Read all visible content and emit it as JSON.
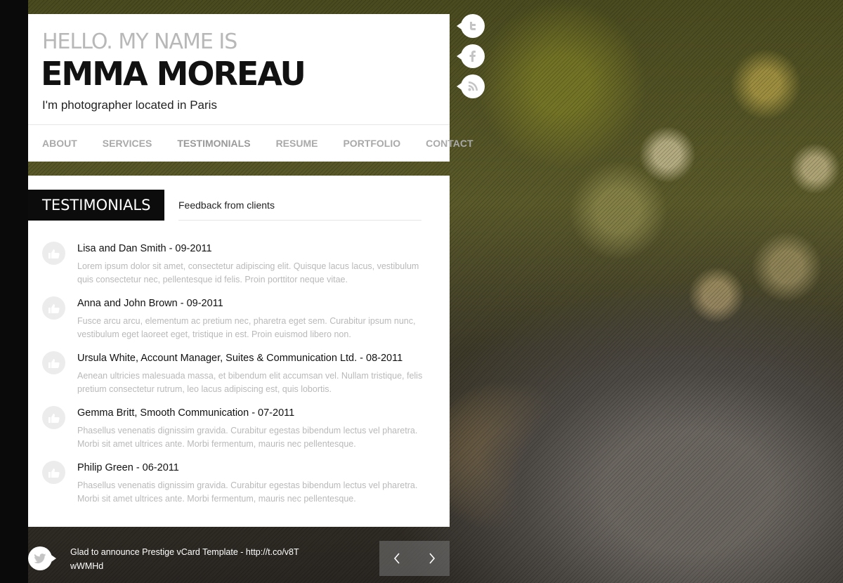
{
  "header": {
    "greeting": "HELLO. MY NAME IS",
    "name": "EMMA MOREAU",
    "tagline": "I'm photographer located in Paris"
  },
  "nav": {
    "items": [
      "ABOUT",
      "SERVICES",
      "TESTIMONIALS",
      "RESUME",
      "PORTFOLIO",
      "CONTACT"
    ],
    "active": "TESTIMONIALS"
  },
  "social": [
    "twitter-icon",
    "facebook-icon",
    "rss-icon"
  ],
  "section": {
    "title": "TESTIMONIALS",
    "subtitle": "Feedback from clients"
  },
  "testimonials": [
    {
      "name": "Lisa and Dan Smith - 09-2011",
      "text": "Lorem ipsum dolor sit amet, consectetur adipiscing elit. Quisque lacus lacus, vestibulum quis consectetur nec, pellentesque id felis. Proin porttitor neque vitae."
    },
    {
      "name": "Anna and John Brown - 09-2011",
      "text": "Fusce arcu arcu, elementum ac pretium nec, pharetra eget sem. Curabitur ipsum nunc, vestibulum eget laoreet eget, tristique in est. Proin euismod libero non."
    },
    {
      "name": "Ursula White, Account Manager, Suites & Communication Ltd. - 08-2011",
      "text": "Aenean ultricies malesuada massa, et bibendum elit accumsan vel. Nullam tristique, felis pretium consectetur rutrum, leo lacus adipiscing est, quis lobortis."
    },
    {
      "name": "Gemma Britt, Smooth Communication - 07-2011",
      "text": "Phasellus venenatis dignissim gravida. Curabitur egestas bibendum lectus vel pharetra. Morbi sit amet ultrices ante. Morbi fermentum, mauris nec pellentesque."
    },
    {
      "name": "Philip Green - 06-2011",
      "text": "Phasellus venenatis dignissim gravida. Curabitur egestas bibendum lectus vel pharetra. Morbi sit amet ultrices ante. Morbi fermentum, mauris nec pellentesque."
    }
  ],
  "footer": {
    "tweet": "Glad to announce Prestige vCard Template - http://t.co/v8TwWMHd",
    "prev_icon": "chevron-left-icon",
    "next_icon": "chevron-right-icon"
  }
}
